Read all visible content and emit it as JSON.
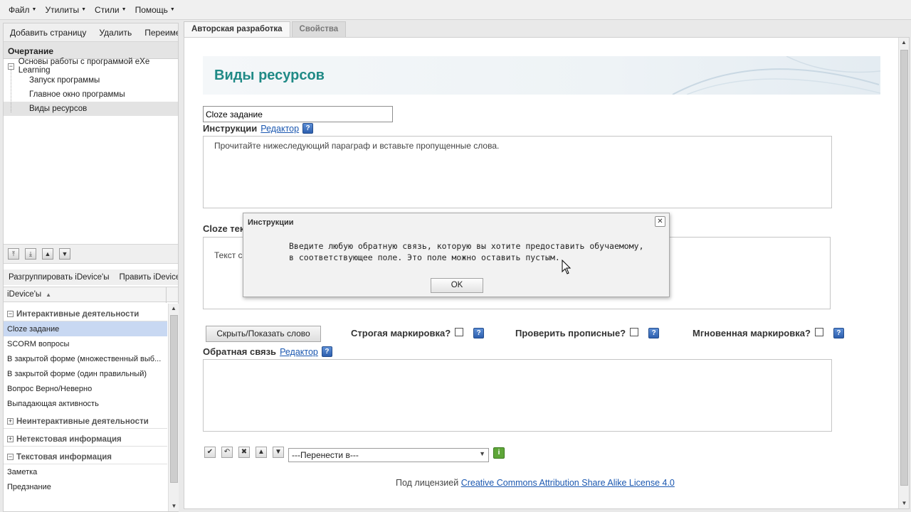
{
  "menu": [
    {
      "label": "Файл"
    },
    {
      "label": "Утилиты"
    },
    {
      "label": "Стили"
    },
    {
      "label": "Помощь"
    }
  ],
  "outline_toolbar": {
    "add": "Добавить страницу",
    "delete": "Удалить",
    "rename": "Переимено"
  },
  "outline": {
    "title": "Очертание",
    "root": "Основы работы с программой eXe Learning",
    "children": [
      "Запуск программы",
      "Главное окно программы",
      "Виды ресурсов"
    ],
    "selected_index": 2
  },
  "idevice_toolbar": {
    "ungroup": "Разгруппировать iDevice'ы",
    "edit": "Править iDevice'ы"
  },
  "idevice_header": "iDevice'ы",
  "idevice_groups": [
    {
      "label": "Интерактивные деятельности",
      "expanded": true,
      "items": [
        "Cloze задание",
        "SCORM вопросы",
        "В закрытой форме (множественный выб...",
        "В закрытой форме (один правильный)",
        "Вопрос Верно/Неверно",
        "Выпадающая активность"
      ]
    },
    {
      "label": "Неинтерактивные деятельности",
      "expanded": false,
      "items": []
    },
    {
      "label": "Нетекстовая информация",
      "expanded": false,
      "items": []
    },
    {
      "label": "Текстовая информация",
      "expanded": true,
      "items": [
        "Заметка",
        "Предзнание"
      ]
    }
  ],
  "tabs": {
    "authoring": "Авторская разработка",
    "properties": "Свойства"
  },
  "page": {
    "title": "Виды ресурсов",
    "idevice_title_value": "Cloze задание",
    "instructions_label": "Инструкции",
    "editor_link": "Редактор",
    "instructions_text": "Прочитайте нижеследующий параграф и вставьте пропущенные слова.",
    "cloze_label": "Cloze тек",
    "cloze_text": "Текст с",
    "hide_show_button": "Скрыть/Показать слово",
    "strict_marking": "Строгая маркировка?",
    "check_caps": "Проверить прописные?",
    "instant_marking": "Мгновенная маркировка?",
    "feedback_label": "Обратная связь",
    "feedback_editor_link": "Редактор",
    "move_to_select": "---Перенести в---",
    "license_prefix": "Под лицензией",
    "license_link": "Creative Commons Attribution Share Alike License 4.0"
  },
  "dialog": {
    "title": "Инструкции",
    "message": "Введите любую обратную связь, которую вы хотите предоставить обучаемому, в соответствующее поле. Это поле можно оставить пустым.",
    "ok": "OK"
  },
  "icons": {
    "help": "help-icon",
    "close": "close-icon",
    "go": "info-icon"
  },
  "colors": {
    "accent_title": "#208a86",
    "link": "#1a57b0",
    "selection": "#c8d8f2"
  }
}
